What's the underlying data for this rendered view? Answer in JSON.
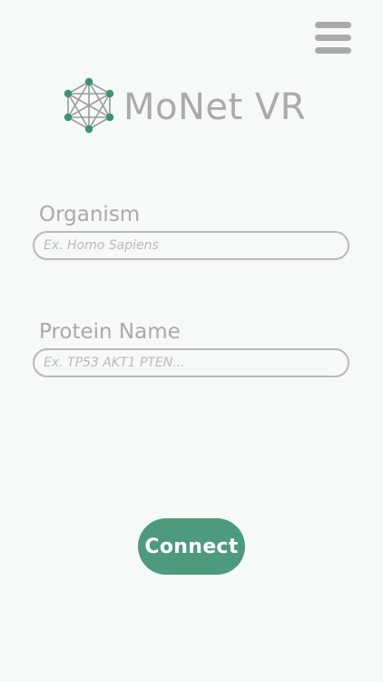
{
  "header": {
    "app_title": "MoNet VR",
    "menu_icon": "hamburger-menu-icon",
    "logo_icon": "network-hexagon-icon"
  },
  "form": {
    "organism": {
      "label": "Organism",
      "value": "",
      "placeholder": "Ex. Homo Sapiens"
    },
    "protein": {
      "label": "Protein Name",
      "value": "",
      "placeholder": "Ex. TP53 AKT1 PTEN..."
    }
  },
  "actions": {
    "connect_label": "Connect"
  },
  "colors": {
    "background": "#f5f9f8",
    "accent": "#4e9a7c",
    "muted_text": "#a9abaa",
    "logo_edges": "#9a9c9b"
  }
}
